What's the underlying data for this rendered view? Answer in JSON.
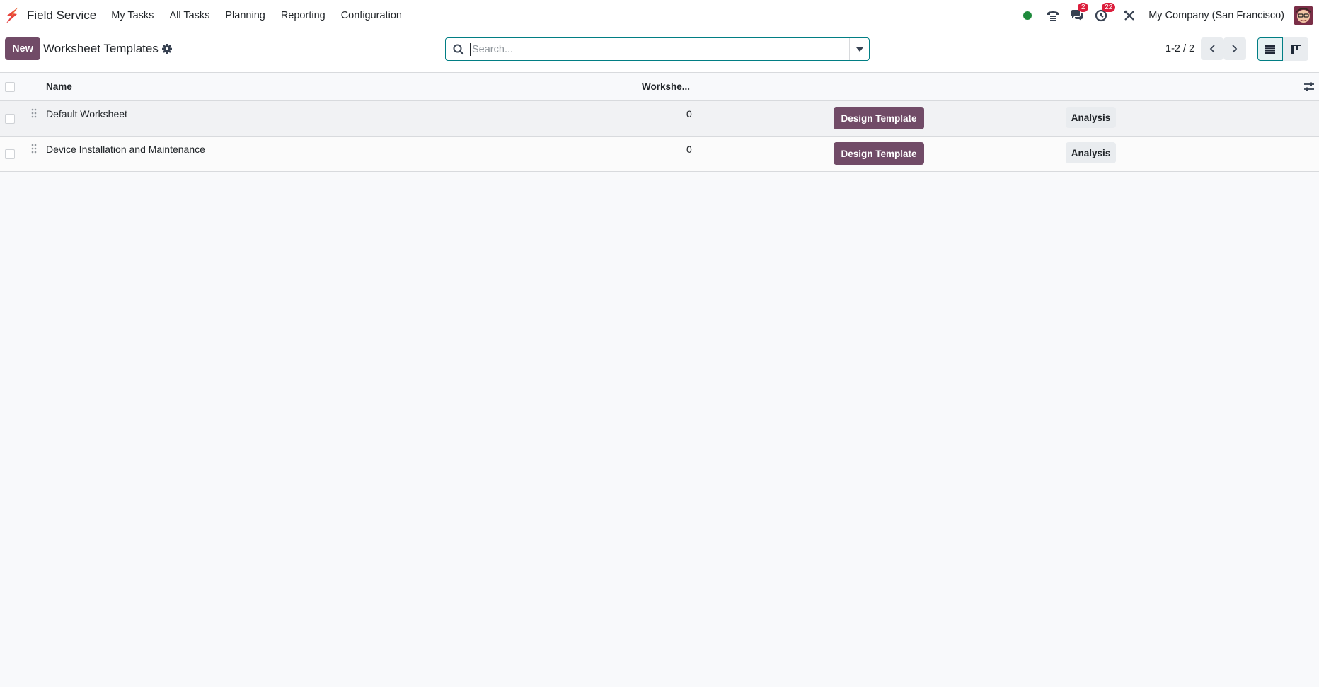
{
  "navbar": {
    "app_name": "Field Service",
    "menu": [
      "My Tasks",
      "All Tasks",
      "Planning",
      "Reporting",
      "Configuration"
    ],
    "messages_badge": "2",
    "activities_badge": "22",
    "company": "My Company (San Francisco)",
    "status_color": "#1e8a3c",
    "brand_color": "#714b67"
  },
  "control_panel": {
    "new_label": "New",
    "title": "Worksheet Templates",
    "search_placeholder": "Search...",
    "pager": "1-2 / 2"
  },
  "table": {
    "columns": {
      "name": "Name",
      "worksheets": "Workshe..."
    },
    "rows": [
      {
        "name": "Default Worksheet",
        "count": "0",
        "design_label": "Design Template",
        "analysis_label": "Analysis"
      },
      {
        "name": "Device Installation and Maintenance",
        "count": "0",
        "design_label": "Design Template",
        "analysis_label": "Analysis"
      }
    ]
  }
}
